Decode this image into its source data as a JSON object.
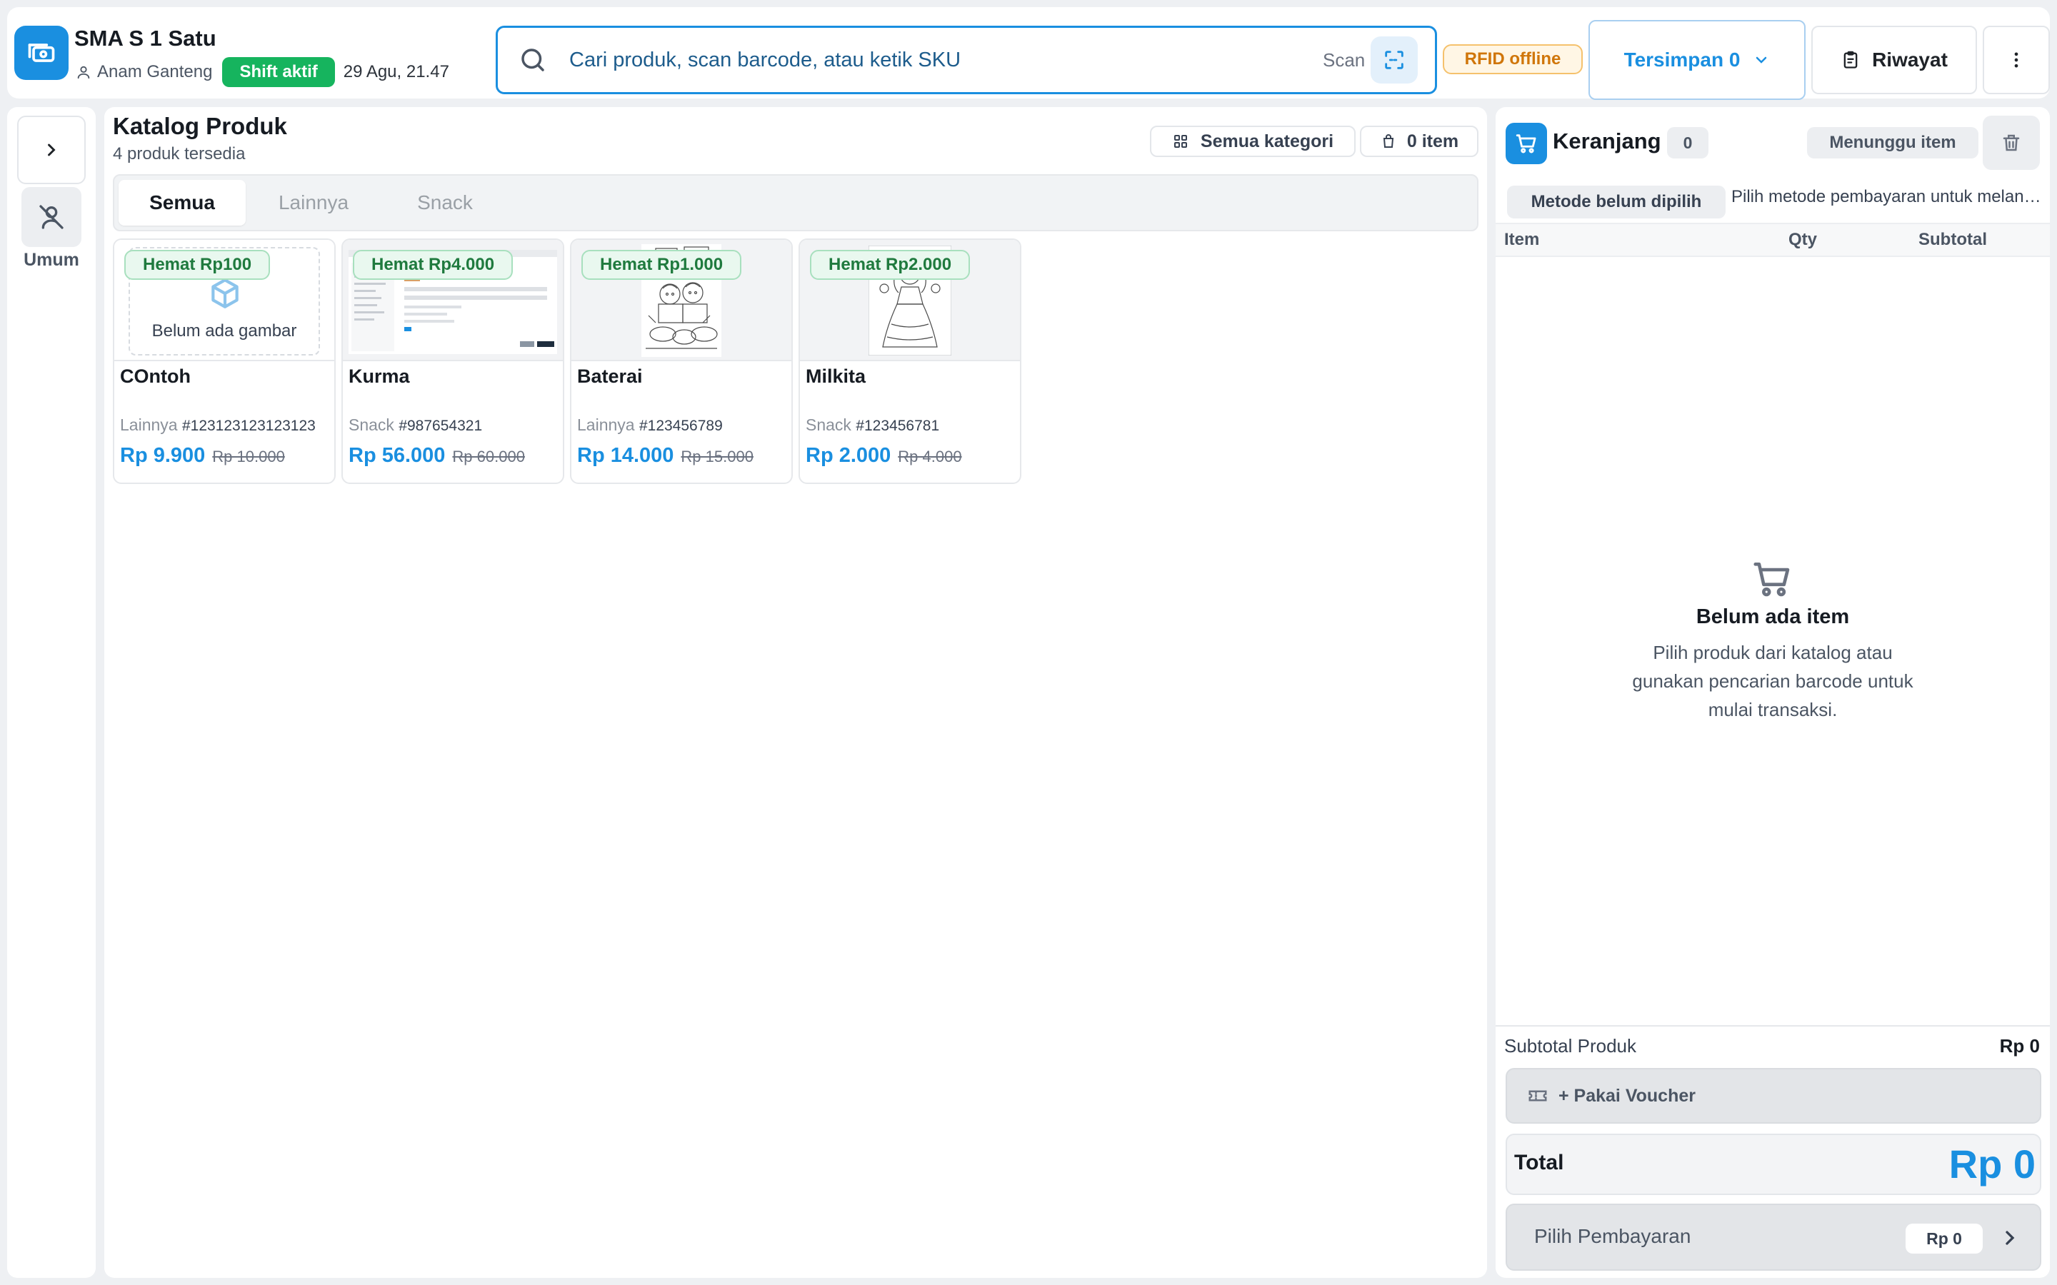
{
  "header": {
    "store_name": "SMA S 1 Satu",
    "user_name": "Anam Ganteng",
    "shift_badge": "Shift aktif",
    "datetime": "29 Agu, 21.47",
    "search": {
      "placeholder": "Cari produk, scan barcode, atau ketik SKU"
    },
    "scan_label": "Scan",
    "rfid_status": "RFID offline",
    "saved_label": "Tersimpan 0",
    "history_label": "Riwayat",
    "icons": [
      "cash-register-icon",
      "user-icon",
      "search-icon",
      "scan-icon",
      "chevron-down-icon",
      "clipboard-icon",
      "more-vertical-icon"
    ]
  },
  "sidebar": {
    "customer_label": "Umum",
    "icons": [
      "chevron-right-icon",
      "user-off-icon"
    ]
  },
  "catalog": {
    "title": "Katalog Produk",
    "subtitle": "4 produk tersedia",
    "category_filter": "Semua kategori",
    "item_count": "0 item",
    "tabs": [
      {
        "label": "Semua",
        "active": true
      },
      {
        "label": "Lainnya",
        "active": false
      },
      {
        "label": "Snack",
        "active": false
      }
    ],
    "products": [
      {
        "badge": "Hemat Rp100",
        "name": "COntoh",
        "category": "Lainnya",
        "sku": "#123123123123123",
        "price": "Rp 9.900",
        "old_price": "Rp 10.000",
        "image": "Belum ada gambar"
      },
      {
        "badge": "Hemat Rp4.000",
        "name": "Kurma",
        "category": "Snack",
        "sku": "#987654321",
        "price": "Rp 56.000",
        "old_price": "Rp 60.000"
      },
      {
        "badge": "Hemat Rp1.000",
        "name": "Baterai",
        "category": "Lainnya",
        "sku": "#123456789",
        "price": "Rp 14.000",
        "old_price": "Rp 15.000"
      },
      {
        "badge": "Hemat Rp2.000",
        "name": "Milkita",
        "category": "Snack",
        "sku": "#123456781",
        "price": "Rp 2.000",
        "old_price": "Rp 4.000"
      }
    ]
  },
  "cart": {
    "title": "Keranjang",
    "count": "0",
    "status": "Menunggu item",
    "method_badge": "Metode belum dipilih",
    "method_hint": "Pilih metode pembayaran untuk melanjutkan",
    "columns": {
      "item": "Item",
      "qty": "Qty",
      "subtotal": "Subtotal"
    },
    "empty_title": "Belum ada item",
    "empty_desc": "Pilih produk dari katalog atau gunakan pencarian barcode untuk mulai transaksi.",
    "subtotal_label": "Subtotal Produk",
    "subtotal_value": "Rp 0",
    "voucher_label": "+ Pakai Voucher",
    "total_label": "Total",
    "total_value": "Rp 0",
    "pay_label": "Pilih Pembayaran",
    "pay_amount": "Rp 0"
  },
  "colors": {
    "accent": "#1a8fe0",
    "shift_active": "#16b45e",
    "rfid_warning": "#d0760a",
    "discount_badge": "#1f7a3e"
  }
}
